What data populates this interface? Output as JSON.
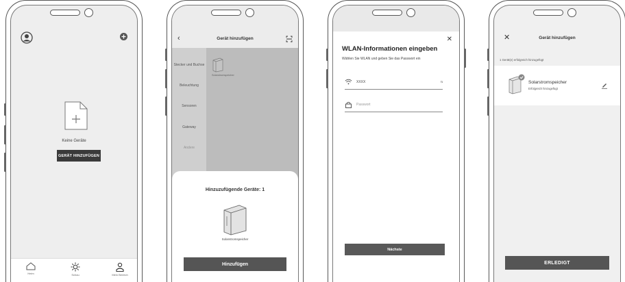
{
  "phone1": {
    "empty_label": "Keine Geräte",
    "add_button": "GERÄT HINZUFÜGEN",
    "tabs": [
      {
        "label": "Heim",
        "icon": "home-icon"
      },
      {
        "label": "Schau",
        "icon": "sun-icon"
      },
      {
        "label": "Mein Bereich",
        "icon": "person-icon"
      }
    ]
  },
  "phone2": {
    "title": "Gerät hinzufügen",
    "categories": [
      "Stecker und Buchse",
      "Beleuchtung",
      "Sensoren",
      "Gateway",
      "Andere"
    ],
    "grid_device": "Solarstromspeicher",
    "sheet_title": "Hinzuzufügende Geräte: 1",
    "sheet_device": "Solarstromspeicher",
    "add_button": "Hinzufügen"
  },
  "phone3": {
    "title": "WLAN-Informationen eingeben",
    "subtitle": "Wählen Sie WLAN und geben Sie das Passwort ein",
    "wifi_value": "XXXX",
    "switch_label": "⇆",
    "password_placeholder": "Passwort",
    "next_button": "Nächste"
  },
  "phone4": {
    "title": "Gerät hinzufügen",
    "status": "1 Gerät(e) erfolgreich hinzugefügt",
    "device_name": "Solarstromspeicher",
    "device_sub": "Erfolgreich hinzugefügt",
    "done_button": "ERLEDIGT"
  }
}
